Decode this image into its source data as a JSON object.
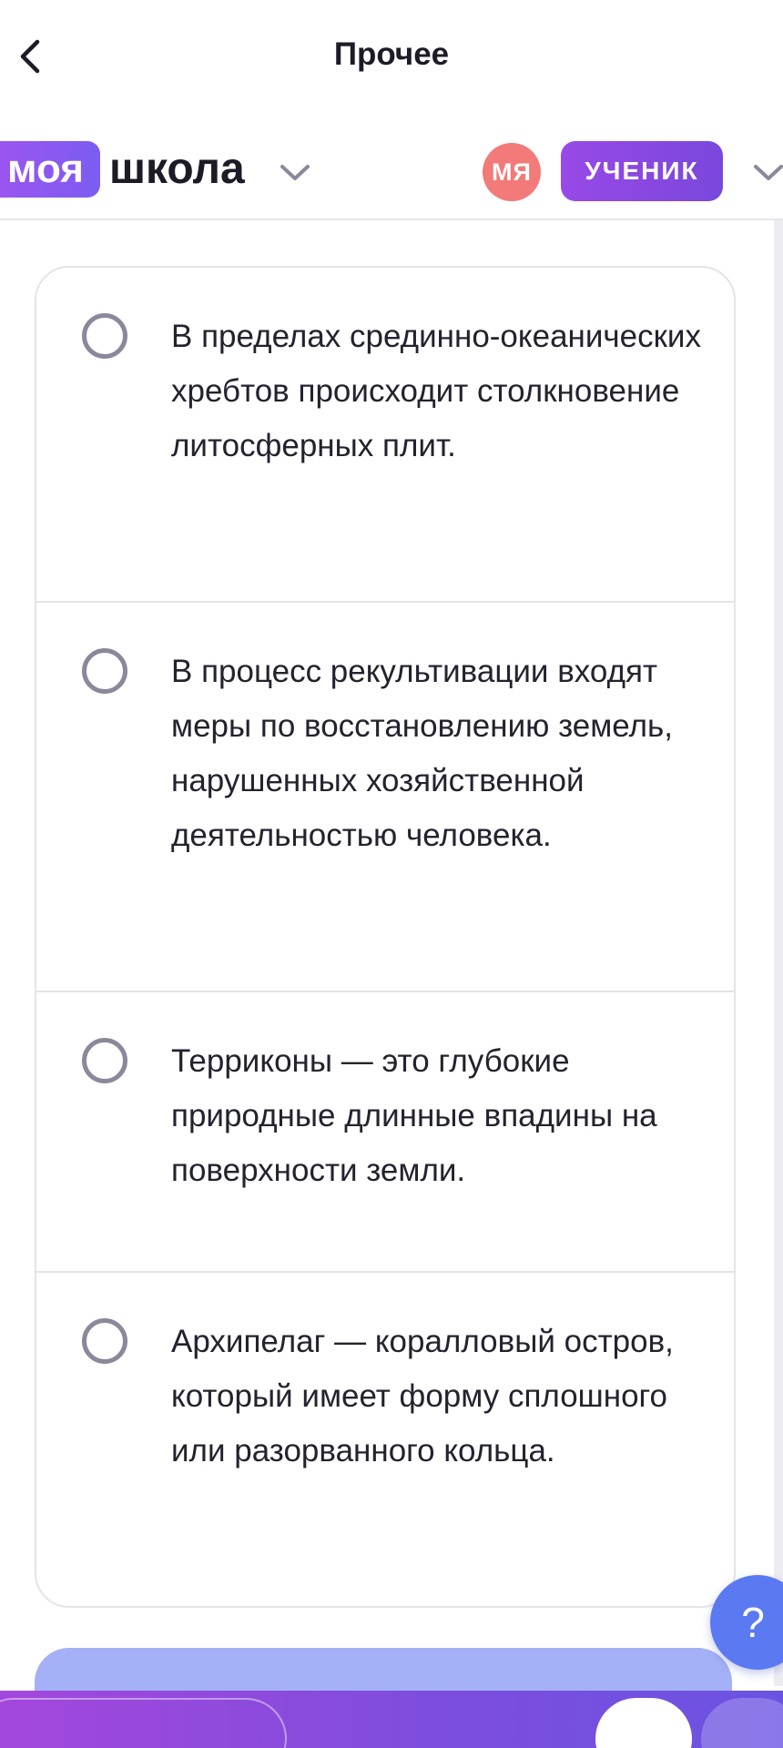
{
  "navbar": {
    "title": "Прочее",
    "back_icon": "chevron-left-icon"
  },
  "brand": {
    "logo_part1": "моя",
    "logo_part2": "школа",
    "school_dropdown_icon": "chevron-down-icon",
    "avatar_initials": "МЯ",
    "role": "УЧЕНИК",
    "role_dropdown_icon": "chevron-down-icon"
  },
  "quiz": {
    "options": [
      {
        "text": "В пределах срединно-океанических хребтов происходит столкновение литосферных плит."
      },
      {
        "text": "В процесс рекультивации входят меры по восстановлению земель, нарушенных хозяйственной деятельностью человека."
      },
      {
        "text": "Терриконы — это глубокие природные длинные впадины на поверхности земли."
      },
      {
        "text": "Архипелаг — коралловый остров, который имеет форму сплошного или разорванного кольца."
      }
    ]
  },
  "help": {
    "label": "?"
  },
  "colors": {
    "accent_purple": "#8b4fe6",
    "avatar_red": "#f27a78",
    "submit_disabled": "#a4b1f6",
    "help_blue": "#5b7af2"
  }
}
